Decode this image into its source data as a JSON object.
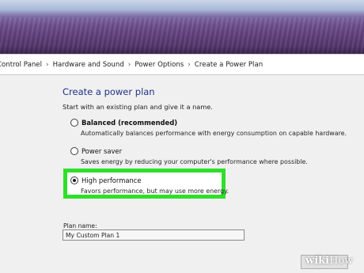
{
  "breadcrumb": {
    "items": [
      "Control Panel",
      "Hardware and Sound",
      "Power Options",
      "Create a Power Plan"
    ],
    "separator": "›"
  },
  "main": {
    "title": "Create a power plan",
    "intro": "Start with an existing plan and give it a name.",
    "options": [
      {
        "label": "Balanced (recommended)",
        "description": "Automatically balances performance with energy consumption on capable hardware.",
        "selected": false,
        "bold": true
      },
      {
        "label": "Power saver",
        "description": "Saves energy by reducing your computer's performance where possible.",
        "selected": false,
        "bold": false
      },
      {
        "label": "High performance",
        "description": "Favors performance, but may use more energy.",
        "selected": true,
        "bold": false
      }
    ],
    "highlight_color": "#2ee02a",
    "plan_name": {
      "label": "Plan name:",
      "value": "My Custom Plan 1"
    }
  },
  "watermark": {
    "text_a": "wiki",
    "text_b": "How"
  }
}
